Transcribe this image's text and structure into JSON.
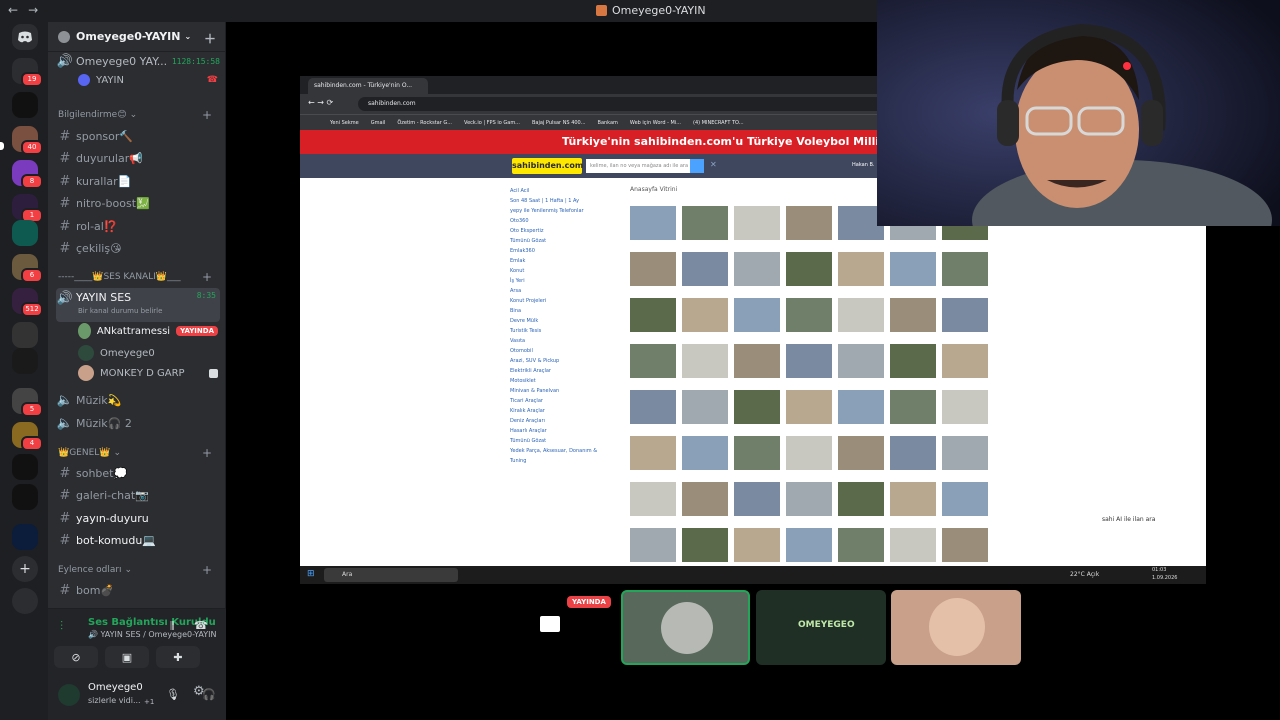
{
  "window": {
    "title": "Omeyege0-YAYIN",
    "back": "←",
    "forward": "→"
  },
  "rail": {
    "badges": [
      "19",
      "40",
      "8",
      "1",
      "6",
      "512",
      "5",
      "4"
    ]
  },
  "server": {
    "name": "Omeyege0-YAYIN"
  },
  "current_voice": {
    "name": "Omeyege0 YAY...",
    "time": "1128:15:58",
    "sub": "YAYIN"
  },
  "categories": {
    "info": "Bilgilendirme😊",
    "ses": "-----____👑SES KANALI👑___",
    "genel": "👑GENEL👑",
    "eglence": "Eylence odları"
  },
  "text_channels": {
    "sponsor": "sponsor🔨",
    "duyurular": "duyurular📢",
    "kurallar": "kurallar📄",
    "nitro": "nitro-boost💹",
    "rolal": "rol-al⁉️",
    "cekilis": "çekiliş😘",
    "sohbet": "sohbet💭",
    "galeri": "galeri-chat📷",
    "yayin_duyuru": "yayın-duyuru",
    "bot": "bot-komudu💻",
    "bom": "bom💣"
  },
  "voice_channel": {
    "name": "YAYIN SES",
    "time": "8:35",
    "status": "Bir kanal durumu belirle",
    "users": [
      {
        "name": "ANkattramessi",
        "live": "YAYINDA"
      },
      {
        "name": "Omeyege0"
      },
      {
        "name": "MONKEY D GARP"
      }
    ]
  },
  "other_voice": {
    "muzik1": "Müzik💫",
    "muzik2": "Müzik🎧 2"
  },
  "voice_panel": {
    "title": "Ses Bağlantısı Kuruldu",
    "subtitle": "🔊 YAYIN SES / Omeyege0-YAYIN"
  },
  "user_panel": {
    "name": "Omeyege0",
    "status": "sizlerle vidi...",
    "extra": "+1"
  },
  "screen": {
    "tab_title": "sahibinden.com - Türkiye'nin O...",
    "url": "sahibinden.com",
    "bookmarks": [
      "Yeni Sekme",
      "Gmail",
      "Özetim - Rockstar G...",
      "Veck.io | FPS io Gam...",
      "Bajaj Pulsar NS 400...",
      "Bankam",
      "Web için Word - Mi...",
      "(4) MINECRAFT TO..."
    ],
    "banner": "Türkiye'nin sahibinden.com'u Türkiye Voleybol Milli Takımları Ana",
    "logo": "sahibinden.com",
    "search_placeholder": "kelime, ilan no veya mağaza adı ile ara",
    "user": "Hakan B.",
    "vitrin": "Anasayfa Vitrini",
    "side_links": [
      "Acil Acil",
      "Son 48 Saat | 1 Hafta | 1 Ay",
      "yepy  ile Yenilenmiş Telefonlar",
      "Oto360",
      "Oto Ekspertiz",
      "Tümünü Gözat",
      "Emlak360",
      "Emlak",
      "Konut",
      "İş Yeri",
      "Arsa",
      "Konut Projeleri",
      "Bina",
      "Devre Mülk",
      "Turistik Tesis",
      "Vasıta",
      "Otomobil",
      "Arazi, SUV & Pickup",
      "Elektrikli Araçlar",
      "Motosiklet",
      "Minivan & Panelvan",
      "Ticari Araçlar",
      "Kiralık Araçlar",
      "Deniz Araçları",
      "Hasarlı Araçlar",
      "Tümünü Gözat",
      "Yedek Parça, Aksesuar, Donanım & Tuning"
    ],
    "taskbar_search": "Ara",
    "weather": "22°C  Açık",
    "clock": "01:03",
    "date": "1.09.2026",
    "sahi_text": "sahi AI ile ilan ara"
  },
  "participants": {
    "live": "YAYINDA",
    "omeyege_label": "OMEYEGEO"
  }
}
